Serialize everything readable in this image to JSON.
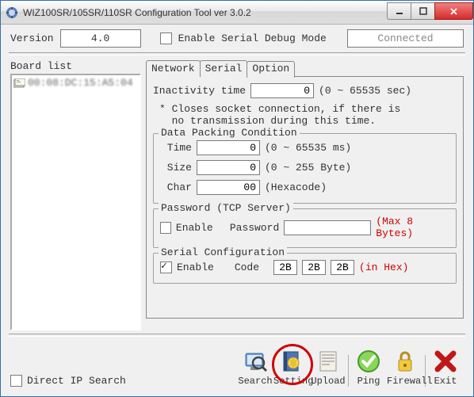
{
  "window": {
    "title": "WIZ100SR/105SR/110SR Configuration Tool ver 3.0.2"
  },
  "header": {
    "version_label": "Version",
    "version_value": "4.0",
    "debug_label": "Enable Serial Debug Mode",
    "debug_checked": false,
    "status": "Connected"
  },
  "board": {
    "label": "Board list",
    "items": [
      "00:08:DC:15:A5:04"
    ]
  },
  "tabs": {
    "network": "Network",
    "serial": "Serial",
    "option": "Option",
    "active": "option"
  },
  "option": {
    "inactivity_label": "Inactivity time",
    "inactivity_value": "0",
    "inactivity_unit": "(0 ~ 65535 sec)",
    "note1": "* Closes socket connection, if there is",
    "note2": "no transmission during this time.",
    "dpc": {
      "title": "Data Packing Condition",
      "time_label": "Time",
      "time_value": "0",
      "time_unit": "(0 ~ 65535 ms)",
      "size_label": "Size",
      "size_value": "0",
      "size_unit": "(0 ~ 255 Byte)",
      "char_label": "Char",
      "char_value": "00",
      "char_unit": "(Hexacode)"
    },
    "pw": {
      "title": "Password (TCP Server)",
      "enable_label": "Enable",
      "enable_checked": false,
      "pw_label": "Password",
      "pw_value": "",
      "note": "(Max 8 Bytes)"
    },
    "sc": {
      "title": "Serial Configuration",
      "enable_label": "Enable",
      "enable_checked": true,
      "code_label": "Code",
      "c1": "2B",
      "c2": "2B",
      "c3": "2B",
      "note": "(in Hex)"
    }
  },
  "footer": {
    "direct_ip_label": "Direct IP Search",
    "direct_ip_checked": false,
    "buttons": {
      "search": "Search",
      "setting": "Setting",
      "upload": "Upload",
      "ping": "Ping",
      "firewall": "Firewall",
      "exit": "Exit"
    }
  }
}
